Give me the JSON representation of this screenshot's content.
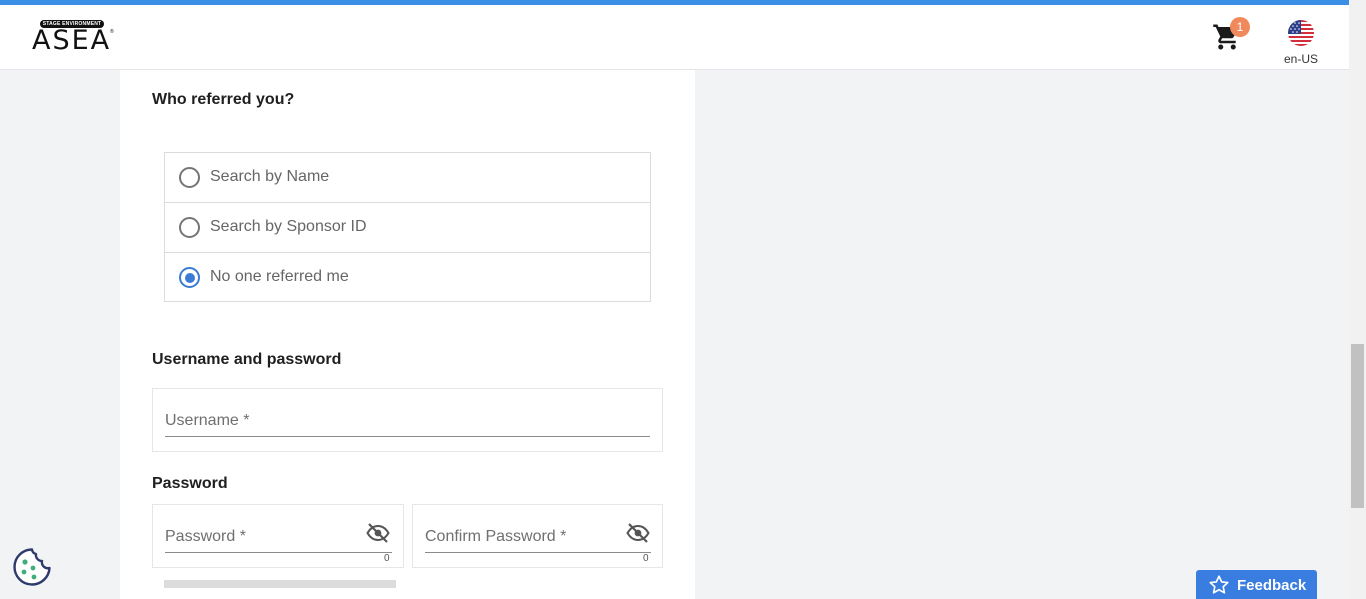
{
  "header": {
    "logo_text": "ASEA",
    "logo_env_badge": "STAGE ENVIRONMENT",
    "logo_tm": "®",
    "cart_icon": "shopping-cart-icon",
    "cart_count": "1",
    "language_label": "en-US",
    "language_icon": "us-flag-icon",
    "accent_color": "#3b8fe6",
    "badge_color": "#f08a5d"
  },
  "referral": {
    "title": "Who referred you?",
    "options": [
      {
        "label": "Search by Name",
        "checked": false
      },
      {
        "label": "Search by Sponsor ID",
        "checked": false
      },
      {
        "label": "No one referred me",
        "checked": true
      }
    ],
    "radio_color": "#3a7bd5"
  },
  "credentials": {
    "title": "Username and password",
    "username_placeholder": "Username *",
    "password_title": "Password",
    "password_placeholder": "Password *",
    "password_counter": "0",
    "confirm_placeholder": "Confirm Password *",
    "confirm_counter": "0",
    "visibility_icon": "eye-off-icon"
  },
  "cookie_icon": "cookie-icon",
  "feedback": {
    "label": "Feedback",
    "icon": "star-icon",
    "color": "#3a7de0"
  }
}
